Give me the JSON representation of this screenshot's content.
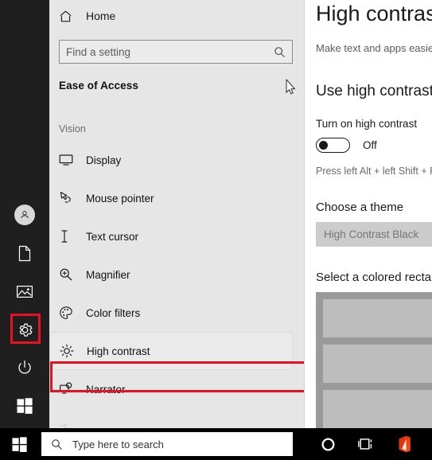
{
  "rail": {
    "items": [
      {
        "name": "account",
        "icon": "account-avatar-icon",
        "selected": false
      },
      {
        "name": "documents",
        "icon": "document-icon",
        "selected": false
      },
      {
        "name": "pictures",
        "icon": "pictures-icon",
        "selected": false
      },
      {
        "name": "settings",
        "icon": "gear-icon",
        "selected": true
      },
      {
        "name": "power",
        "icon": "power-icon",
        "selected": false
      },
      {
        "name": "start",
        "icon": "windows-logo-icon",
        "selected": false
      }
    ],
    "highlight_color": "#e81123"
  },
  "nav": {
    "home_label": "Home",
    "home_icon": "home-icon",
    "search": {
      "placeholder": "Find a setting",
      "value": "",
      "icon": "search-icon"
    },
    "section_title": "Ease of Access",
    "group_label": "Vision",
    "items": [
      {
        "label": "Display",
        "icon": "monitor-icon",
        "selected": false
      },
      {
        "label": "Mouse pointer",
        "icon": "mouse-pointer-icon",
        "selected": false
      },
      {
        "label": "Text cursor",
        "icon": "text-cursor-icon",
        "selected": false
      },
      {
        "label": "Magnifier",
        "icon": "magnifier-icon",
        "selected": false
      },
      {
        "label": "Color filters",
        "icon": "palette-icon",
        "selected": false
      },
      {
        "label": "High contrast",
        "icon": "brightness-icon",
        "selected": true
      },
      {
        "label": "Narrator",
        "icon": "narrator-icon",
        "selected": false
      }
    ]
  },
  "content": {
    "title": "High contrast",
    "subtitle": "Make text and apps easier to see",
    "section_heading": "Use high contrast",
    "toggle_label": "Turn on high contrast",
    "toggle_state": "Off",
    "toggle_on": false,
    "shortcut_hint": "Press left Alt + left Shift + Print screen",
    "theme_label": "Choose a theme",
    "theme_value": "High Contrast Black",
    "preview_label": "Select a colored rectangle",
    "preview_rows": 3
  },
  "taskbar": {
    "start_icon": "windows-logo-icon",
    "search": {
      "placeholder": "Type here to search",
      "value": "",
      "icon": "search-icon"
    },
    "icons": [
      {
        "name": "cortana-icon"
      },
      {
        "name": "task-view-icon"
      },
      {
        "name": "office-icon"
      }
    ],
    "office_color": "#eb3c00"
  },
  "cursor": {
    "icon": "mouse-arrow-cursor"
  }
}
